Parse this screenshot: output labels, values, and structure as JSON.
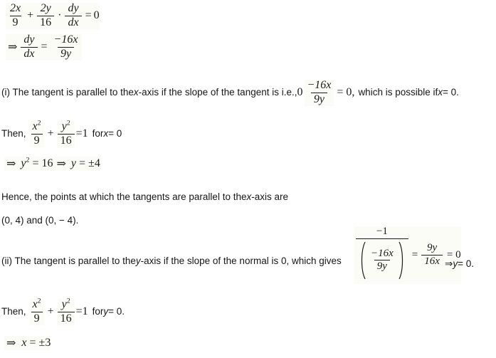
{
  "document": {
    "type": "math-solution-steps",
    "topic": "Tangents to the ellipse x^2/9 + y^2/16 = 1"
  },
  "eq1": {
    "t_num1": "2x",
    "t_den1": "9",
    "plus": "+",
    "t_num2": "2y",
    "t_den2": "16",
    "dot": "·",
    "t_num3": "dy",
    "t_den3": "dx",
    "equals": "=",
    "rhs": "0"
  },
  "eq2": {
    "implies": "⇒",
    "num1": "dy",
    "den1": "dx",
    "equals": "=",
    "num2": "−16x",
    "den2": "9y"
  },
  "part_i": {
    "text_before": "(i) The tangent is parallel to the ",
    "var_x": "x",
    "text_mid": "-axis if the slope of the tangent is i.e., ",
    "lead_zero": "0",
    "frac_num": "−16x",
    "frac_den": "9y",
    "eq_zero": "= 0,",
    "text_after": "which is possible if ",
    "cond_var": "x",
    "cond_rest": " = 0."
  },
  "then_x": {
    "label": "Then,",
    "num1": "x",
    "exp1": "2",
    "den1": "9",
    "plus": "+",
    "num2": "y",
    "exp2": "2",
    "den2": "16",
    "equals": "=1",
    "for_text": "for ",
    "for_var": "x",
    "for_rest": " = 0"
  },
  "y_squared": {
    "implies": "⇒",
    "var": "y",
    "exp": "2",
    "eq1": "= 16",
    "implies2": "⇒",
    "var2": "y",
    "eq2": "= ±4"
  },
  "hence": {
    "line1_before": "Hence, the points at which the tangents are parallel to the ",
    "line1_var": "x",
    "line1_after": "-axis are",
    "line2": "(0, 4) and (0, − 4)."
  },
  "part_ii": {
    "text_before": "(ii) The tangent is parallel to the ",
    "var_y": "y",
    "text_mid": "-axis if the slope of the normal is 0, which gives",
    "outer_num": "−1",
    "inner_num": "−16x",
    "inner_den": "9y",
    "equals1": "=",
    "num2": "9y",
    "den2": "16x",
    "equals2": "= 0",
    "implies": "⇒ ",
    "result_var": "y",
    "result_rest": " = 0."
  },
  "then_y": {
    "label": "Then,",
    "num1": "x",
    "exp1": "2",
    "den1": "9",
    "plus": "+",
    "num2": "y",
    "exp2": "2",
    "den2": "16",
    "equals": "=1",
    "for_text": "for ",
    "for_var": "y",
    "for_rest": " = 0."
  },
  "x_result": {
    "implies": "⇒",
    "var": "x",
    "rest": "= ±3"
  }
}
